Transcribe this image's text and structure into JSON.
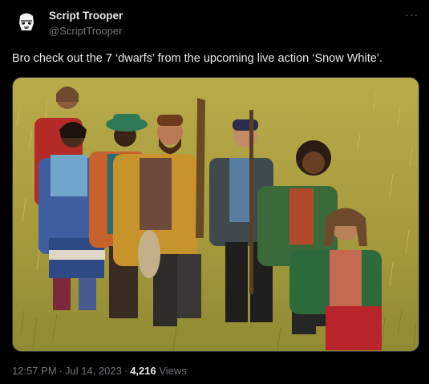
{
  "author": {
    "name": "Script Trooper",
    "handle": "@ScriptTrooper",
    "avatar_icon": "stormtrooper-helmet-icon"
  },
  "more_icon": "more-options-icon",
  "more_glyph": "···",
  "tweet": {
    "text": "Bro check out the 7 ‘dwarfs’ from the upcoming live action ‘Snow White’."
  },
  "media": {
    "alt": "Photo of seven people standing in a tall grass meadow"
  },
  "meta": {
    "time": "12:57 PM",
    "separator": "·",
    "date": "Jul 14, 2023",
    "views_count": "4,216",
    "views_label": "Views"
  },
  "colors": {
    "background": "#000000",
    "text_primary": "#e7e9ea",
    "text_secondary": "#71767b",
    "border": "#2f3336"
  }
}
